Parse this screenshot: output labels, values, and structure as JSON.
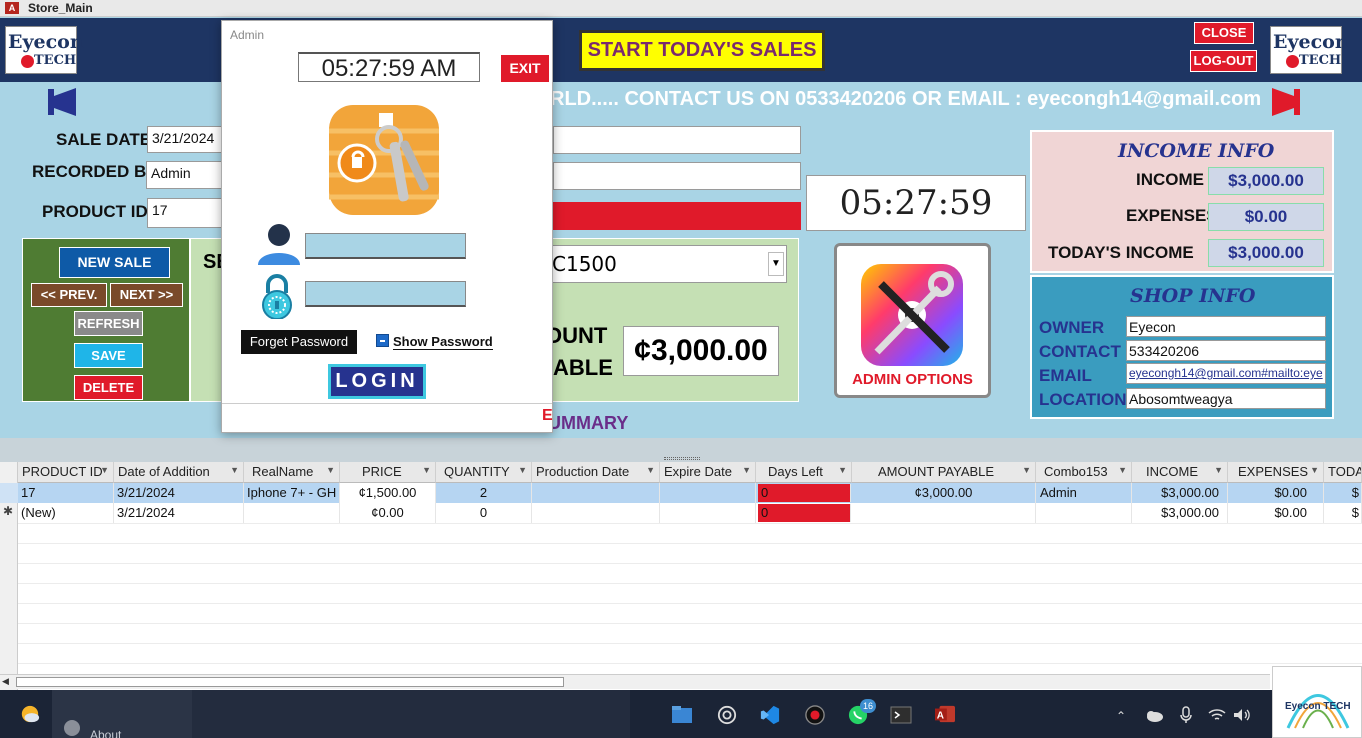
{
  "window": {
    "title": "Store_Main"
  },
  "header": {
    "logo_line1": "Eyecon",
    "logo_line2": "TECH",
    "start_sales_label": "START TODAY'S SALES",
    "close_label": "CLOSE",
    "logout_label": "LOG-OUT"
  },
  "marquee": {
    "text": "RLD..... CONTACT US ON 0533420206 OR EMAIL : eyecongh14@gmail.com"
  },
  "form": {
    "sale_date_label": "SALE DATE",
    "sale_date_value": "3/21/2024",
    "recorded_by_label": "RECORDED BY",
    "recorded_by_value": "Admin",
    "product_id_label": "PRODUCT ID",
    "product_id_value": "17",
    "select_label_partial": "SE",
    "product_combo_value": "C1500",
    "amount_label_1": "OUNT",
    "amount_label_2": "ABLE",
    "amount_value": "¢3,000.00",
    "summary_partial": "UMMARY"
  },
  "clock": {
    "time": "05:27:59 AM"
  },
  "nav": {
    "new_sale": "NEW SALE",
    "prev": "<< PREV.",
    "next": "NEXT >>",
    "refresh": "REFRESH",
    "save": "SAVE",
    "delete": "DELETE"
  },
  "admin_options": {
    "label": "ADMIN OPTIONS"
  },
  "income_info": {
    "title": "INCOME INFO",
    "income_label": "INCOME",
    "income_value": "$3,000.00",
    "expenses_label": "EXPENSES",
    "expenses_value": "$0.00",
    "today_label": "TODAY'S INCOME",
    "today_value": "$3,000.00"
  },
  "shop_info": {
    "title": "SHOP INFO",
    "owner_label": "OWNER",
    "owner_value": "Eyecon",
    "contact_label": "CONTACT",
    "contact_value": "533420206",
    "email_label": "EMAIL",
    "email_value": "eyecongh14@gmail.com#mailto:eye",
    "location_label": "LOCATION",
    "location_value": "Abosomtweagya"
  },
  "login_dialog": {
    "title": "Admin",
    "time": "05:27:59 AM",
    "exit_label": "EXIT",
    "username_value": "",
    "password_value": "",
    "forget_password": "Forget Password",
    "show_password": "Show Password",
    "login_label": "LOGIN",
    "bottom_partial": "E"
  },
  "table": {
    "columns": [
      "PRODUCT ID",
      "Date of Addition",
      "RealName",
      "PRICE",
      "QUANTITY",
      "Production Date",
      "Expire Date",
      "Days Left",
      "AMOUNT PAYABLE",
      "Combo153",
      "INCOME",
      "EXPENSES",
      "TODA"
    ],
    "rows": [
      [
        "17",
        "3/21/2024",
        "Iphone 7+ - GH",
        "¢1,500.00",
        "2",
        "",
        "",
        "0",
        "¢3,000.00",
        "Admin",
        "$3,000.00",
        "$0.00",
        "$"
      ],
      [
        "(New)",
        "3/21/2024",
        "",
        "¢0.00",
        "0",
        "",
        "",
        "0",
        "",
        "",
        "$3,000.00",
        "$0.00",
        "$"
      ]
    ]
  },
  "taskbar": {
    "whatsapp_badge": "16",
    "about_text": "About",
    "logo_text": "Eyecon TECH"
  },
  "colors": {
    "header_bg": "#1e3563",
    "form_bg": "#a9d4e5",
    "accent_red": "#e01a2a",
    "nav_green": "#4f7c33",
    "mid_green": "#c5e0b4"
  }
}
